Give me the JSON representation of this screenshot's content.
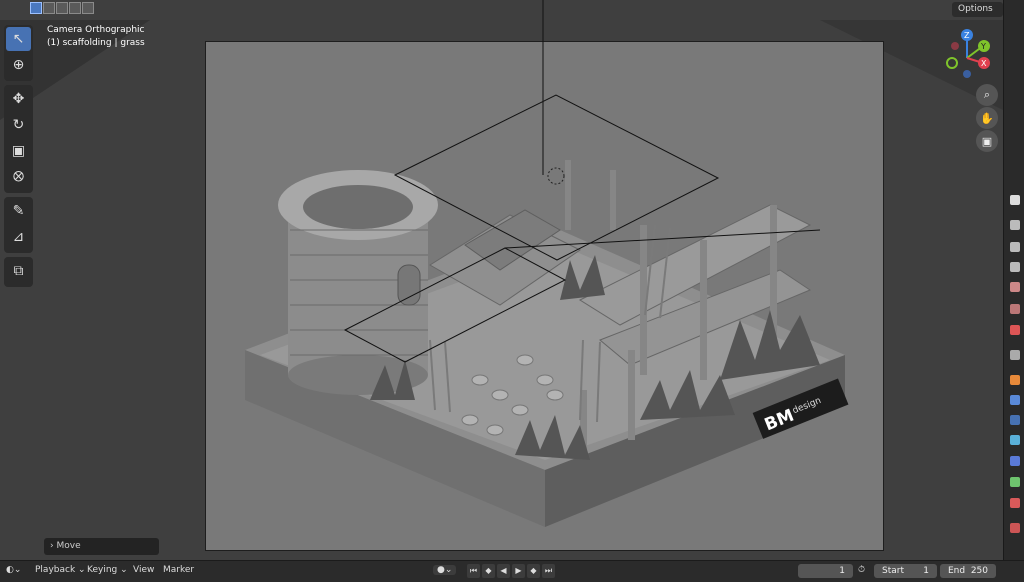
{
  "header": {
    "options_label": "Options ⌄"
  },
  "viewport": {
    "view_name": "Camera Orthographic",
    "object_info": "(1) scaffolding | grass",
    "watermark_big": "BM",
    "watermark_small": "design"
  },
  "gizmo": {
    "z": "Z",
    "y": "Y",
    "x": "X"
  },
  "last_operator": "Move",
  "timeline": {
    "menus": [
      "Playback ⌄",
      "Keying ⌄",
      "View",
      "Marker"
    ],
    "current_frame": "1",
    "start_label": "Start",
    "start_value": "1",
    "end_label": "End",
    "end_value": "250"
  },
  "colors": {
    "accent": "#4772b3",
    "axis_x": "#e0404f",
    "axis_y": "#7fc42b",
    "axis_z": "#3a82e0"
  }
}
